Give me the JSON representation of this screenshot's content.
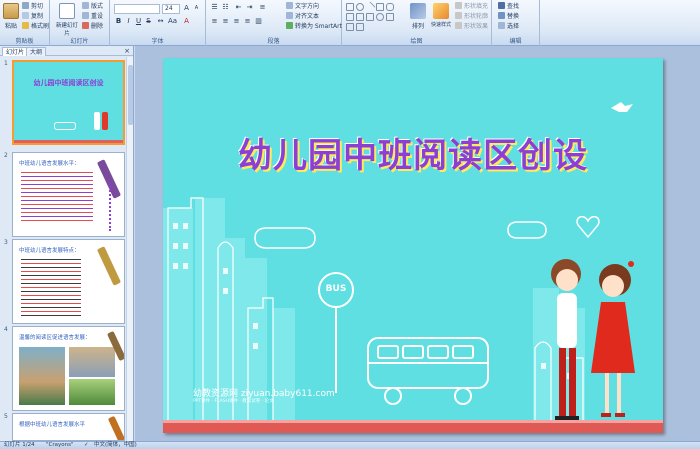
{
  "ribbon": {
    "groups": {
      "clipboard": "剪贴板",
      "slides": "幻灯片",
      "font": "字体",
      "paragraph": "段落",
      "drawing": "绘图",
      "editing": "编辑"
    },
    "clipboard": {
      "paste": "粘贴",
      "cut": "剪切",
      "copy": "复制",
      "format_painter": "格式刷"
    },
    "slides": {
      "new_slide": "新建幻灯片",
      "layout": "版式",
      "reset": "重设",
      "delete": "删除"
    },
    "font": {
      "font_name": "",
      "font_size": "24"
    },
    "paragraph": {
      "text_direction": "文字方向",
      "align_text": "对齐文本",
      "smartart": "转换为 SmartArt"
    },
    "drawing": {
      "arrange": "排列",
      "quick_styles": "快速样式",
      "shape_fill": "形状填充",
      "shape_outline": "形状轮廓",
      "shape_effects": "形状效果"
    },
    "editing": {
      "find": "查找",
      "replace": "替换",
      "select": "选择"
    }
  },
  "panel": {
    "tabs": [
      "幻灯片",
      "大纲"
    ],
    "close": "×",
    "slides": [
      {
        "num": "1",
        "title": "幼儿园中班阅读区创设"
      },
      {
        "num": "2",
        "title": "中班幼儿语言发展水平："
      },
      {
        "num": "3",
        "title": "中班幼儿语言发展特点："
      },
      {
        "num": "4",
        "title": "温馨的阅读区促进语言发展："
      },
      {
        "num": "5",
        "title": "根据中班幼儿语言发展水平"
      }
    ]
  },
  "slide": {
    "title": "幼儿园中班阅读区创设",
    "bus_sign": "BUS",
    "watermark": "幼教资源网 ziyuan.baby611.com",
    "watermark_sub": "PPT课件 · FLASH课件 · 教案试卷 · 论文"
  },
  "status": {
    "slide_info": "幻灯片 1/24",
    "theme": "\"Crayons\"",
    "language": "中文(简体，中国)"
  },
  "colors": {
    "slide_bg": "#5fdfe2",
    "title": "#8b3fd4",
    "selection": "#f39c32"
  }
}
